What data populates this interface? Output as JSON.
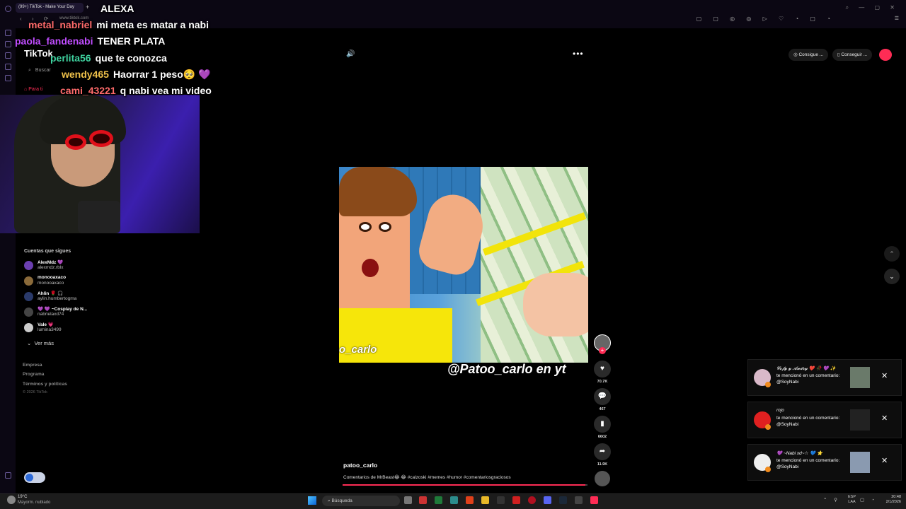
{
  "browser": {
    "tab_title": "(99+) TikTok - Make Your Day",
    "url": "www.tiktok.com"
  },
  "tiktok": {
    "logo": "TikTok",
    "search_placeholder": "Buscar",
    "for_you": "Para ti",
    "following_title": "Cuentas que sigues",
    "following": [
      {
        "name": "AlexMdz 💜",
        "handle": "alexmdz.rblx"
      },
      {
        "name": "monooaxaco",
        "handle": "monooaxaco"
      },
      {
        "name": "Ahlin 🌹 🎧",
        "handle": "aylin.humbertogma"
      },
      {
        "name": "💜 💜 ~Cosplay de N...",
        "handle": "nabrielaxd74"
      },
      {
        "name": "Vale 💗",
        "handle": "lumina3499"
      }
    ],
    "see_more": "Ver más",
    "footer_links": [
      "Empresa",
      "Programa",
      "Términos y políticas"
    ],
    "copyright": "© 2026 TikTok",
    "get_coins": "Consigue ...",
    "get_app": "Conseguir ...",
    "video": {
      "watermark_left": "o_carlo",
      "watermark_right": "@Patoo_carlo en yt",
      "author": "patoo_carlo",
      "description": "Comentarios de MrBeast😂 😂 #calzoski #memes #humor #comentariosgraciosos",
      "progress": 0.99
    },
    "actions": {
      "likes": "70.7K",
      "comments": "467",
      "saves": "6602",
      "shares": "11.9K"
    },
    "notifications": [
      {
        "name": "𝓒𝓸𝓯𝔂 𝔂 𝓐𝓷𝓭𝓻𝔂 ❤️ 🥀 💜 ✨",
        "text": "te mencionó en un comentario: @SoyNabi"
      },
      {
        "name": "rojo",
        "text": "te mencionó en un comentario: @SoyNabi"
      },
      {
        "name": "💜 ~Nabi xd~☆ 💙 ⭐",
        "text": "te mencionó en un comentario: @SoyNabi"
      }
    ]
  },
  "chat": [
    {
      "user": "",
      "message": "ALEXA",
      "color": "#ffffff"
    },
    {
      "user": "metal_nabriel",
      "message": "mi meta es matar a nabi",
      "color": "#ff6b6b"
    },
    {
      "user": "paola_fandenabi",
      "message": "TENER PLATA",
      "color": "#c04dff"
    },
    {
      "user": "perlita56",
      "message": "que te conozca",
      "color": "#3fd3a0"
    },
    {
      "user": "wendy465",
      "message": "Haorrar 1 peso🥺 💜",
      "color": "#f0c24b"
    },
    {
      "user": "cami_43221",
      "message": "q nabi vea mi video",
      "color": "#ff6b6b"
    }
  ],
  "taskbar": {
    "temp": "19°C",
    "weather": "Mayorm. nublado",
    "search": "Búsqueda",
    "lang_top": "ESP",
    "lang_bottom": "LAA",
    "time": "20:48",
    "date": "2/1/2026"
  },
  "colors": {
    "accent": "#fe2c55",
    "webcam_bg": "#3b1fae"
  }
}
